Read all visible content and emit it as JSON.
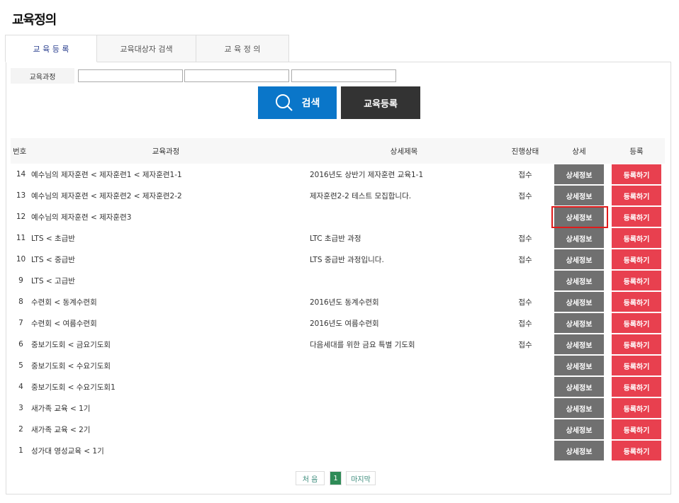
{
  "title": "교육정의",
  "tabs": [
    "교 육 등 록",
    "교육대상자 검색",
    "교 육 정 의"
  ],
  "search": {
    "label": "교육과정",
    "inputs": [
      "",
      "",
      ""
    ],
    "search_button": "검색",
    "register_button": "교육등록"
  },
  "table": {
    "headers": [
      "번호",
      "교육과정",
      "상세제목",
      "진행상태",
      "상세",
      "등록"
    ],
    "detail_label": "상세정보",
    "register_label": "등록하기",
    "rows": [
      {
        "no": "14",
        "course": "예수님의 제자훈련 < 제자훈련1 < 제자훈련1-1",
        "title": "2016년도 상반기 제자훈련 교육1-1",
        "status": "접수"
      },
      {
        "no": "13",
        "course": "예수님의 제자훈련 < 제자훈련2 < 제자훈련2-2",
        "title": "제자훈련2-2 테스트 모집합니다.",
        "status": "접수"
      },
      {
        "no": "12",
        "course": "예수님의 제자훈련 < 제자훈련3",
        "title": "",
        "status": ""
      },
      {
        "no": "11",
        "course": "LTS < 초급반",
        "title": "LTC 초급반 과정",
        "status": "접수"
      },
      {
        "no": "10",
        "course": "LTS < 중급반",
        "title": "LTS 중급반 과정입니다.",
        "status": "접수"
      },
      {
        "no": "9",
        "course": "LTS < 고급반",
        "title": "",
        "status": ""
      },
      {
        "no": "8",
        "course": "수련회 < 동계수련회",
        "title": "2016년도 동계수련회",
        "status": "접수"
      },
      {
        "no": "7",
        "course": "수련회 < 여름수련회",
        "title": "2016년도 여름수련회",
        "status": "접수"
      },
      {
        "no": "6",
        "course": "중보기도회 < 금요기도회",
        "title": "다음세대를 위한 금요 특별 기도회",
        "status": "접수"
      },
      {
        "no": "5",
        "course": "중보기도회 < 수요기도회",
        "title": "",
        "status": ""
      },
      {
        "no": "4",
        "course": "중보기도회 < 수요기도회1",
        "title": "",
        "status": ""
      },
      {
        "no": "3",
        "course": "새가족 교육 < 1기",
        "title": "",
        "status": ""
      },
      {
        "no": "2",
        "course": "새가족 교육 < 2기",
        "title": "",
        "status": ""
      },
      {
        "no": "1",
        "course": "성가대 영성교육 < 1기",
        "title": "",
        "status": ""
      }
    ]
  },
  "pagination": {
    "first": "처 음",
    "current": "1",
    "last": "마지막"
  }
}
